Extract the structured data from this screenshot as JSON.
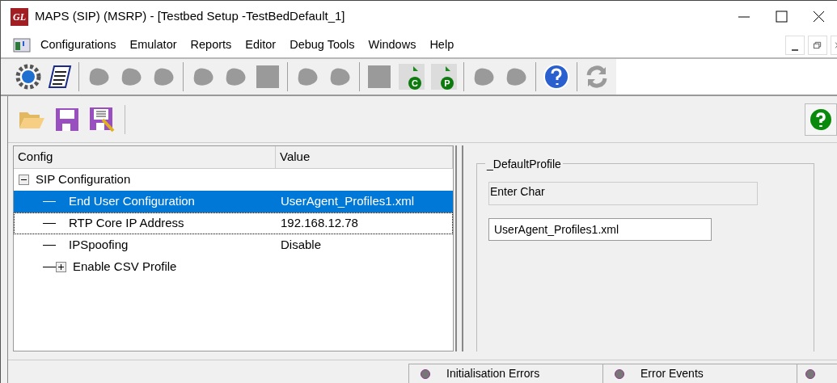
{
  "window": {
    "title": "MAPS (SIP) (MSRP)  - [Testbed Setup -TestBedDefault_1]",
    "logo": "GL"
  },
  "menu": [
    "Configurations",
    "Emulator",
    "Reports",
    "Editor",
    "Debug Tools",
    "Windows",
    "Help"
  ],
  "toolbar": [
    {
      "kind": "gear",
      "disabled": false
    },
    {
      "kind": "notepad",
      "disabled": false
    },
    {
      "kind": "sep"
    },
    {
      "kind": "blob",
      "disabled": true
    },
    {
      "kind": "blob",
      "disabled": true
    },
    {
      "kind": "blob",
      "disabled": true
    },
    {
      "kind": "sep"
    },
    {
      "kind": "blob",
      "disabled": true
    },
    {
      "kind": "blob",
      "disabled": true
    },
    {
      "kind": "square",
      "disabled": true
    },
    {
      "kind": "sep"
    },
    {
      "kind": "blob",
      "disabled": true
    },
    {
      "kind": "blob",
      "disabled": true
    },
    {
      "kind": "sep"
    },
    {
      "kind": "square",
      "disabled": true
    },
    {
      "kind": "doc",
      "badge": "C",
      "disabled": false
    },
    {
      "kind": "doc",
      "badge": "P",
      "disabled": false
    },
    {
      "kind": "sep"
    },
    {
      "kind": "blob",
      "disabled": true
    },
    {
      "kind": "blob",
      "disabled": true
    },
    {
      "kind": "sep"
    },
    {
      "kind": "help",
      "disabled": false
    },
    {
      "kind": "sep"
    },
    {
      "kind": "refresh",
      "disabled": true
    }
  ],
  "tree": {
    "columns": [
      "Config",
      "Value"
    ],
    "rows": [
      {
        "label": "SIP Configuration",
        "expanded": true,
        "selected": false,
        "children": [
          {
            "label": "End User Configuration",
            "value": "UserAgent_Profiles1.xml",
            "selected": true,
            "focused": false
          },
          {
            "label": "RTP Core IP Address",
            "value": "192.168.12.78",
            "selected": false,
            "focused": true
          },
          {
            "label": "IPSpoofing",
            "value": "Disable",
            "selected": false,
            "focused": false
          },
          {
            "label": "Enable CSV Profile",
            "expanded": false,
            "selected": false,
            "focused": false
          }
        ]
      }
    ]
  },
  "detail": {
    "group_title": "_DefaultProfile",
    "prompt": "Enter Char",
    "value": "UserAgent_Profiles1.xml"
  },
  "status_bar": [
    "Initialisation Errors",
    "Error Events"
  ]
}
